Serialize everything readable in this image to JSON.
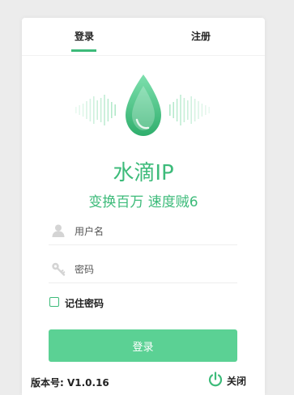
{
  "tabs": {
    "login": "登录",
    "register": "注册",
    "active": "login"
  },
  "brand": {
    "name": "水滴IP",
    "slogan": "变换百万 速度贼6"
  },
  "form": {
    "username": {
      "placeholder": "用户名",
      "value": ""
    },
    "password": {
      "placeholder": "密码",
      "value": ""
    },
    "remember_label": "记住密码",
    "remember_checked": false,
    "submit_label": "登录"
  },
  "footer": {
    "version": "版本号: V1.0.16",
    "close_label": "关闭"
  },
  "icons": {
    "logo": "water-drop-icon",
    "username": "user-icon",
    "password": "key-icon",
    "close": "power-icon"
  },
  "colors": {
    "accent": "#3dbb7a",
    "button": "#5bd194"
  }
}
